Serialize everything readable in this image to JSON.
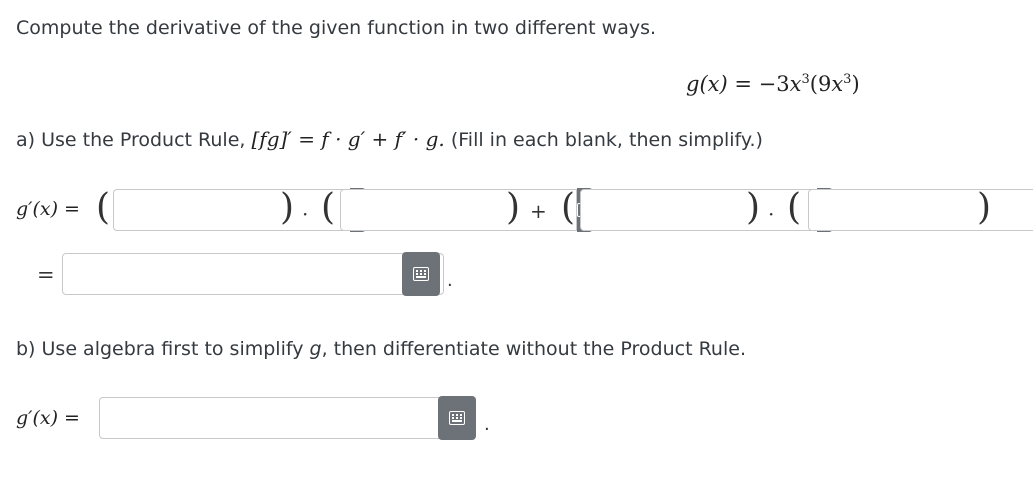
{
  "instruction": "Compute the derivative of the given function in two different ways.",
  "function": {
    "lhs": "g(x)",
    "eq": "=",
    "coef": "−3",
    "var1": "x",
    "exp1": "3",
    "inner_open": "(9",
    "var2": "x",
    "exp2": "3",
    "inner_close": ")"
  },
  "part_a": {
    "lead": "a) Use the Product Rule,",
    "rule": "[fg]′ = f · g′ + f′ · g.",
    "tail": "(Fill in each blank, then simplify.)",
    "g_prime_label": "g′(x) =",
    "eq2": "=",
    "period": "."
  },
  "part_b": {
    "prefix": "b) Use algebra first to simplify",
    "var": "g",
    "suffix": ", then differentiate without the Product Rule.",
    "g_prime_label": "g′(x) =",
    "period": "."
  },
  "symbols": {
    "open_paren": "(",
    "close_paren": ")",
    "cdot": "·",
    "plus": "+"
  },
  "inputs": {
    "a1": "",
    "a2": "",
    "a3": "",
    "a4": "",
    "a_simplified": "",
    "b_answer": ""
  },
  "icons": {
    "keypad": "keypad-icon"
  },
  "colors": {
    "keypad_button": "#6d7278",
    "input_border": "#c8c8c8"
  }
}
